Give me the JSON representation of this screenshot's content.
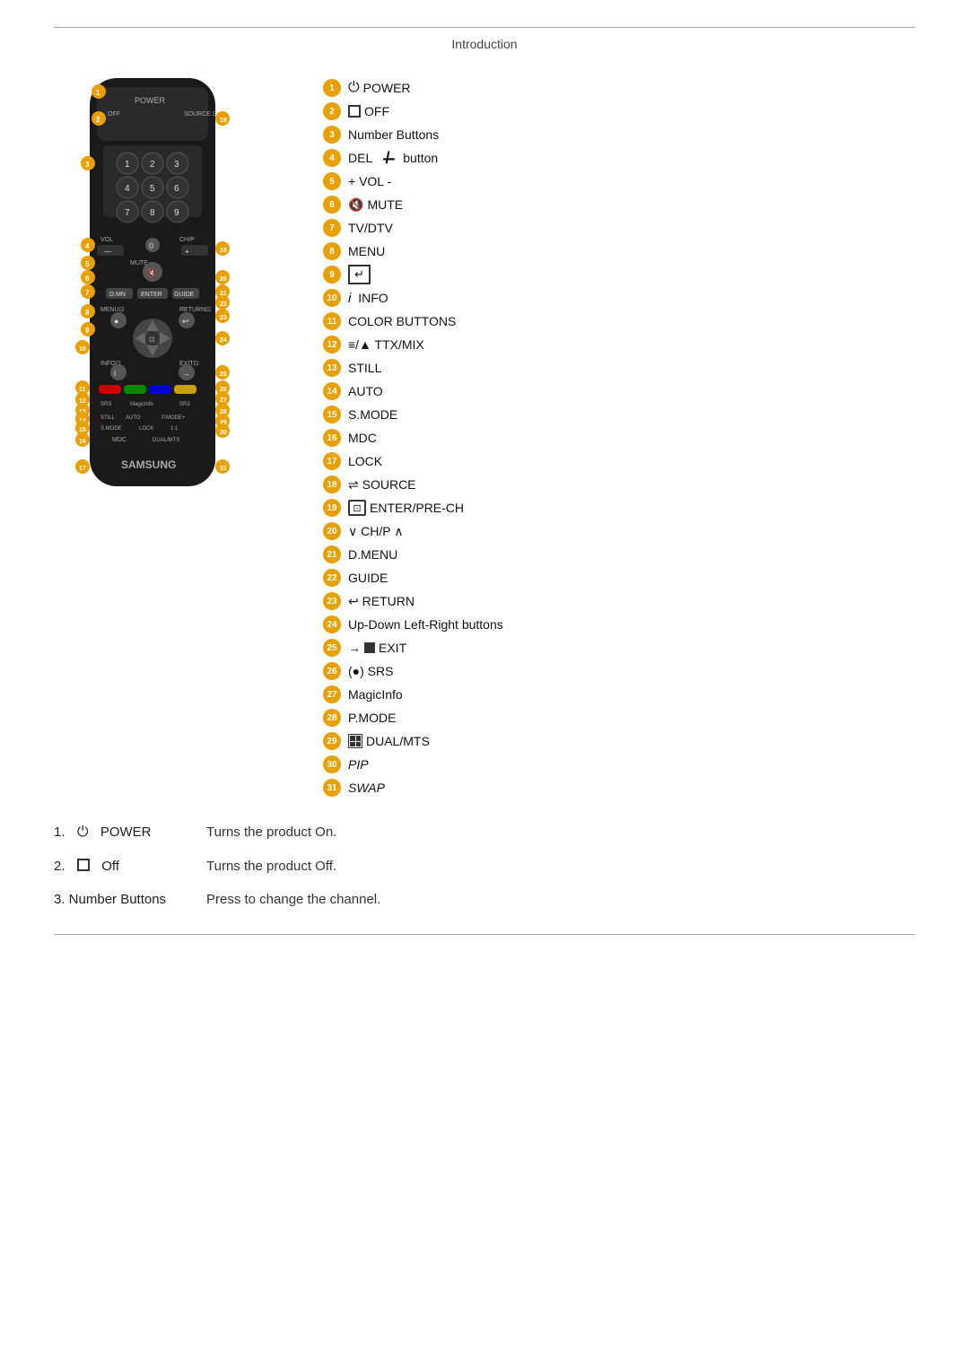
{
  "page": {
    "header": "Introduction"
  },
  "buttons": [
    {
      "num": "1",
      "icon": "⏻",
      "label": "POWER"
    },
    {
      "num": "2",
      "icon": "□",
      "label": "OFF"
    },
    {
      "num": "3",
      "icon": "",
      "label": "Number Buttons"
    },
    {
      "num": "4",
      "icon": "—/—",
      "label": "DEL  button"
    },
    {
      "num": "5",
      "icon": "",
      "label": "+ VOL -"
    },
    {
      "num": "6",
      "icon": "🔇",
      "label": "MUTE"
    },
    {
      "num": "7",
      "icon": "",
      "label": "TV/DTV"
    },
    {
      "num": "8",
      "icon": "",
      "label": "MENU"
    },
    {
      "num": "9",
      "icon": "↵",
      "label": ""
    },
    {
      "num": "10",
      "icon": "i",
      "label": "INFO"
    },
    {
      "num": "11",
      "icon": "",
      "label": "COLOR BUTTONS"
    },
    {
      "num": "12",
      "icon": "≡/▲",
      "label": "TTX/MIX"
    },
    {
      "num": "13",
      "icon": "",
      "label": "STILL"
    },
    {
      "num": "14",
      "icon": "",
      "label": "AUTO"
    },
    {
      "num": "15",
      "icon": "",
      "label": "S.MODE"
    },
    {
      "num": "16",
      "icon": "",
      "label": "MDC"
    },
    {
      "num": "17",
      "icon": "",
      "label": "LOCK"
    },
    {
      "num": "18",
      "icon": "⇌",
      "label": "SOURCE"
    },
    {
      "num": "19",
      "icon": "⊡",
      "label": "ENTER/PRE-CH"
    },
    {
      "num": "20",
      "icon": "",
      "label": "∨ CH/P ∧"
    },
    {
      "num": "21",
      "icon": "",
      "label": "D.MENU"
    },
    {
      "num": "22",
      "icon": "",
      "label": "GUIDE"
    },
    {
      "num": "23",
      "icon": "↩",
      "label": "RETURN"
    },
    {
      "num": "24",
      "icon": "",
      "label": "Up-Down Left-Right buttons"
    },
    {
      "num": "25",
      "icon": "→■",
      "label": "EXIT"
    },
    {
      "num": "26",
      "icon": "(●)",
      "label": "SRS"
    },
    {
      "num": "27",
      "icon": "",
      "label": "MagicInfo"
    },
    {
      "num": "28",
      "icon": "",
      "label": "P.MODE"
    },
    {
      "num": "29",
      "icon": "⊞",
      "label": "DUAL/MTS"
    },
    {
      "num": "30",
      "icon": "",
      "label": "PIP",
      "italic": true
    },
    {
      "num": "31",
      "icon": "",
      "label": "SWAP",
      "italic": true
    }
  ],
  "descriptions": [
    {
      "num": "1.",
      "icon": "⏻",
      "name": "POWER",
      "text": "Turns the product On."
    },
    {
      "num": "2.",
      "icon": "□",
      "name": "Off",
      "text": "Turns the product Off."
    },
    {
      "num": "3.",
      "icon": "",
      "name": "Number Buttons",
      "text": "Press to change the channel."
    }
  ]
}
